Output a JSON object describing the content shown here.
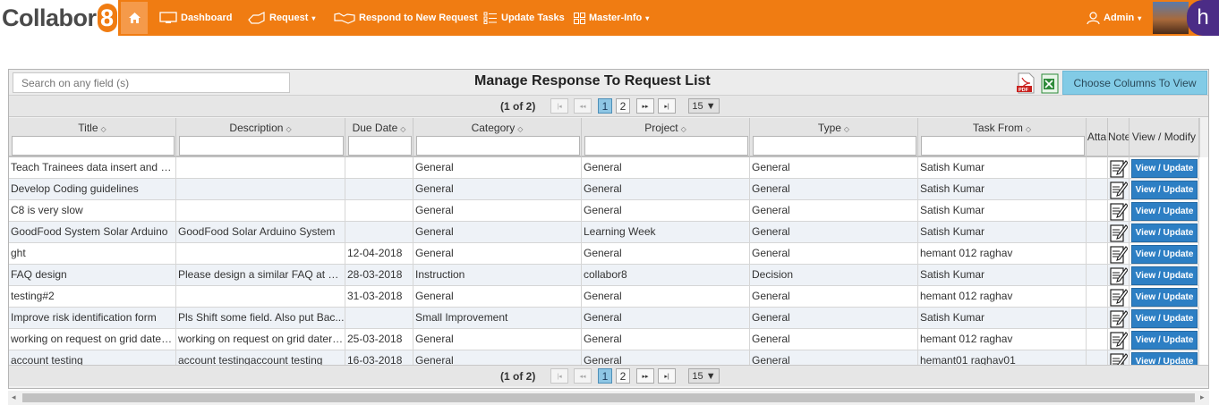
{
  "nav": {
    "logo": "Collabor",
    "logo_eight": "8",
    "items": [
      {
        "label": "Dashboard",
        "icon": "monitor-icon"
      },
      {
        "label": "Request",
        "icon": "request-icon",
        "dropdown": true
      },
      {
        "label": "Respond to New Request",
        "icon": "handshake-icon"
      },
      {
        "label": "Update Tasks",
        "icon": "tasks-icon"
      },
      {
        "label": "Master-Info",
        "icon": "grid-icon",
        "dropdown": true
      }
    ],
    "admin_label": "Admin",
    "avatar_letter": "h",
    "colors": {
      "bar": "#f07c12",
      "avatar": "#4b2c86"
    }
  },
  "panel": {
    "search_placeholder": "Search on any field (s)",
    "title": "Manage Response To Request List",
    "choose_columns": "Choose Columns To View"
  },
  "pager": {
    "info": "(1 of 2)",
    "pages": [
      "1",
      "2"
    ],
    "current_page": "1",
    "page_size": "15 ▼"
  },
  "table": {
    "columns": [
      "Title",
      "Description",
      "Due Date",
      "Category",
      "Project",
      "Type",
      "Task From",
      "Atta",
      "Note",
      "View / Modify"
    ],
    "action_label": "View / Update",
    "rows": [
      {
        "title": "Teach Trainees data insert and d...",
        "description": "",
        "due": "",
        "category": "General",
        "project": "General",
        "type": "General",
        "from": "Satish Kumar"
      },
      {
        "title": "Develop Coding guidelines",
        "description": "",
        "due": "",
        "category": "General",
        "project": "General",
        "type": "General",
        "from": "Satish Kumar"
      },
      {
        "title": "C8 is very slow",
        "description": "",
        "due": "",
        "category": "General",
        "project": "General",
        "type": "General",
        "from": "Satish Kumar"
      },
      {
        "title": "GoodFood System Solar Arduino",
        "description": "GoodFood Solar Arduino System",
        "due": "",
        "category": "General",
        "project": "Learning Week",
        "type": "General",
        "from": "Satish Kumar"
      },
      {
        "title": "ght",
        "description": "",
        "due": "12-04-2018",
        "category": "General",
        "project": "General",
        "type": "General",
        "from": "hemant 012 raghav"
      },
      {
        "title": "FAQ design",
        "description": "Please design a similar FAQ at on...",
        "due": "28-03-2018",
        "category": "Instruction",
        "project": "collabor8",
        "type": "Decision",
        "from": "Satish Kumar"
      },
      {
        "title": "testing#2",
        "description": "",
        "due": "31-03-2018",
        "category": "General",
        "project": "General",
        "type": "General",
        "from": "hemant 012 raghav"
      },
      {
        "title": "Improve risk identification form",
        "description": "Pls Shift some field. Also put Bac...",
        "due": "",
        "category": "Small Improvement",
        "project": "General",
        "type": "General",
        "from": "Satish Kumar"
      },
      {
        "title": "working on request on grid datera...",
        "description": "working on request on grid datera...",
        "due": "25-03-2018",
        "category": "General",
        "project": "General",
        "type": "General",
        "from": "hemant 012 raghav"
      },
      {
        "title": "account testing",
        "description": "account testingaccount testing",
        "due": "16-03-2018",
        "category": "General",
        "project": "General",
        "type": "General",
        "from": "hemant01 raghav01"
      }
    ]
  }
}
